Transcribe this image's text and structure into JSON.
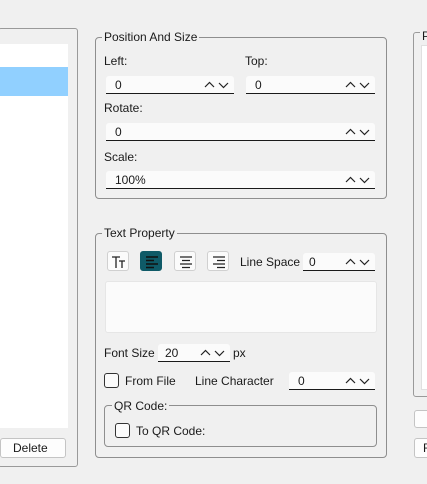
{
  "left_panel": {
    "delete_label": "Delete"
  },
  "position_size": {
    "legend": "Position And Size",
    "left": {
      "label": "Left:",
      "value": "0"
    },
    "top": {
      "label": "Top:",
      "value": "0"
    },
    "rotate": {
      "label": "Rotate:",
      "value": "0"
    },
    "scale": {
      "label": "Scale:",
      "value": "100%"
    }
  },
  "text_property": {
    "legend": "Text Property",
    "line_space": {
      "label": "Line Space",
      "value": "0"
    },
    "text_content": "",
    "font_size": {
      "label": "Font Size",
      "value": "20",
      "unit": "px"
    },
    "from_file": {
      "label": "From File",
      "checked": false
    },
    "line_character": {
      "label": "Line Character",
      "value": "0"
    },
    "qr_code": {
      "legend": "QR Code:",
      "to_qr": {
        "label": "To QR Code:",
        "checked": false
      }
    }
  },
  "right_panel": {
    "legend": "P",
    "button_label": "F"
  },
  "colors": {
    "selection": "#91d0ff",
    "align_active": "#0f5a67",
    "background": "#f0f0f0"
  }
}
